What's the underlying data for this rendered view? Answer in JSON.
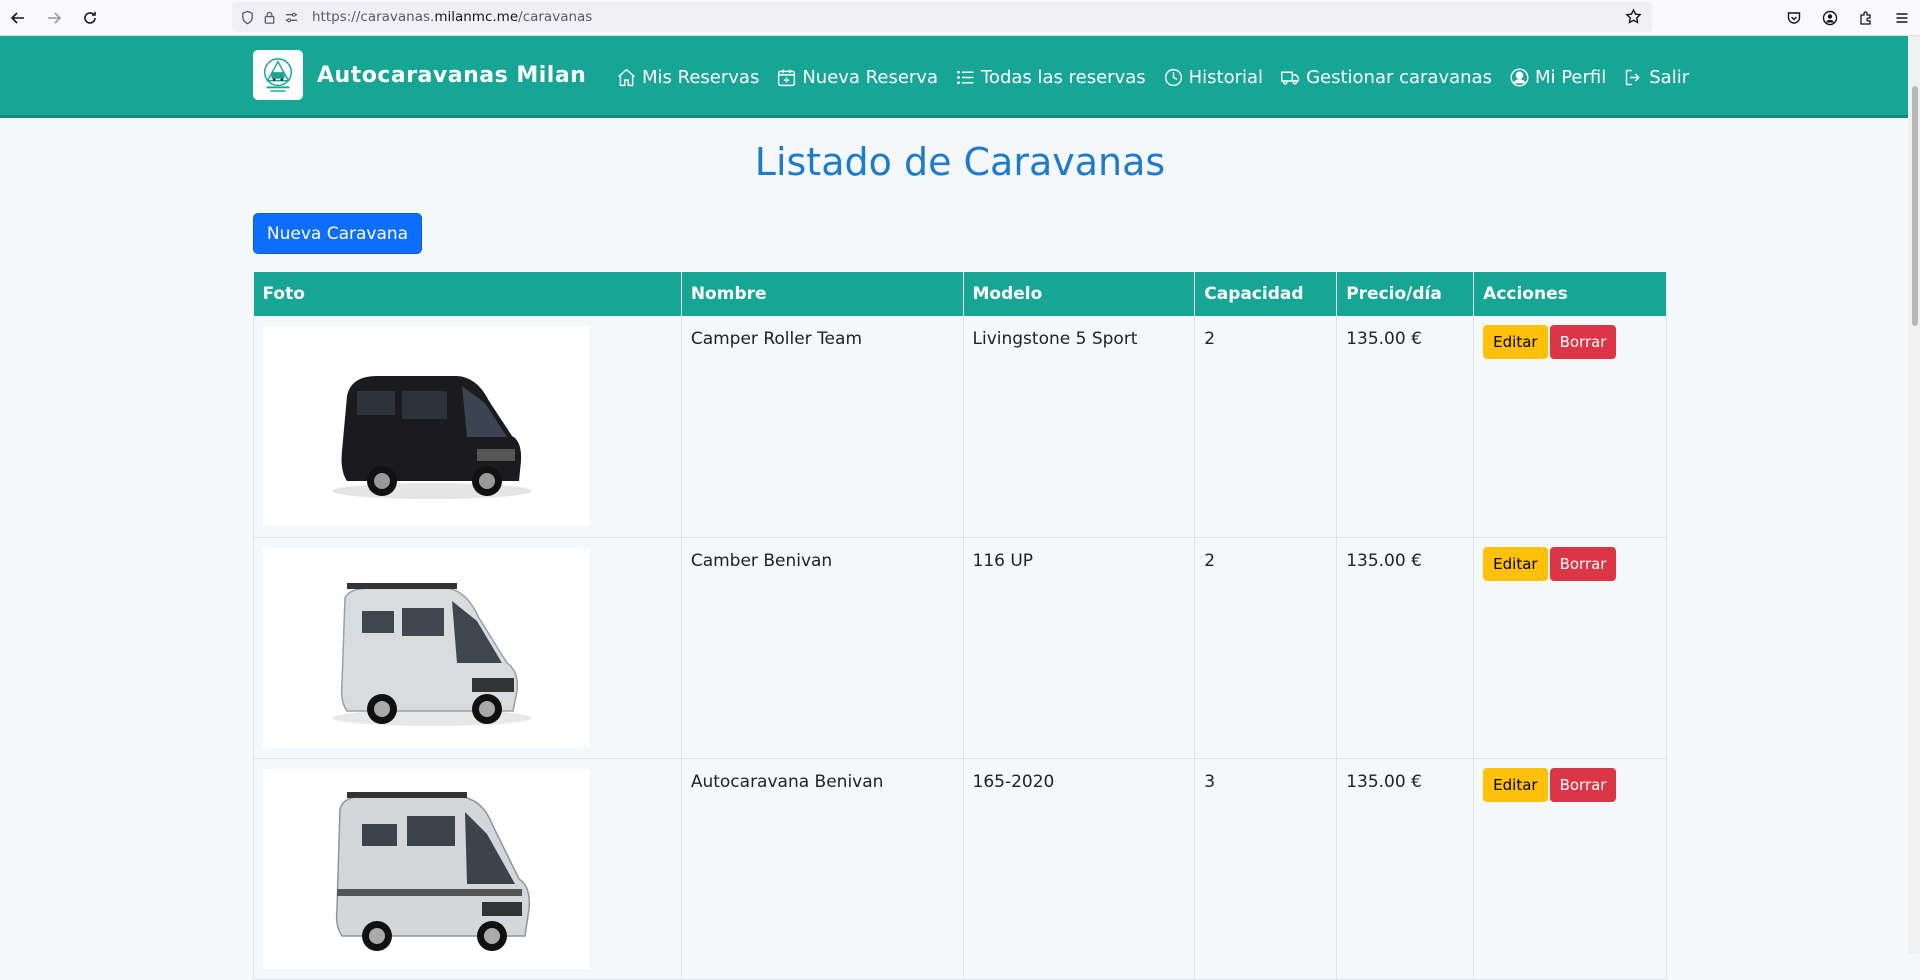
{
  "browser": {
    "url_prefix": "https://caravanas.",
    "url_host": "milanmc.me",
    "url_path": "/caravanas"
  },
  "brand": {
    "name": "Autocaravanas Milan",
    "logo_text": "Alquiler Caravanas Milan"
  },
  "nav": {
    "items": [
      {
        "label": "Mis Reservas",
        "icon": "home-icon"
      },
      {
        "label": "Nueva Reserva",
        "icon": "calendar-plus-icon"
      },
      {
        "label": "Todas las reservas",
        "icon": "list-icon"
      },
      {
        "label": "Historial",
        "icon": "clock-icon"
      },
      {
        "label": "Gestionar caravanas",
        "icon": "truck-icon"
      },
      {
        "label": "Mi Perfil",
        "icon": "user-circle-icon"
      },
      {
        "label": "Salir",
        "icon": "logout-icon"
      }
    ]
  },
  "page": {
    "title": "Listado de Caravanas",
    "new_button": "Nueva Caravana"
  },
  "table": {
    "headers": [
      "Foto",
      "Nombre",
      "Modelo",
      "Capacidad",
      "Precio/día",
      "Acciones"
    ],
    "rows": [
      {
        "nombre": "Camper Roller Team",
        "modelo": "Livingstone 5 Sport",
        "capacidad": "2",
        "precio": "135.00 €",
        "photo_color": "#1b1b1f"
      },
      {
        "nombre": "Camber Benivan",
        "modelo": "116 UP",
        "capacidad": "2",
        "precio": "135.00 €",
        "photo_color": "#d9dcdf"
      },
      {
        "nombre": "Autocaravana Benivan",
        "modelo": "165-2020",
        "capacidad": "3",
        "precio": "135.00 €",
        "photo_color": "#d4d7da"
      }
    ],
    "edit_label": "Editar",
    "delete_label": "Borrar"
  },
  "colors": {
    "navbar": "#17a696",
    "primary": "#0d6efd",
    "title": "#1f7acc",
    "warning": "#ffc107",
    "danger": "#dc3545"
  }
}
